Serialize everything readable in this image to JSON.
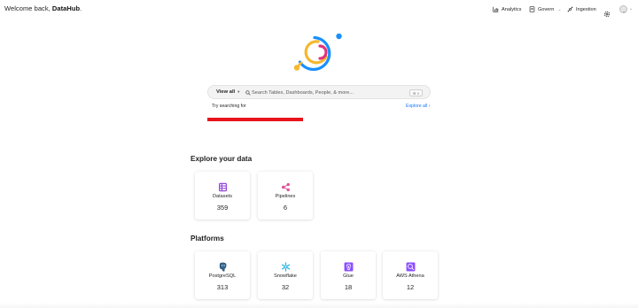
{
  "header": {
    "welcome_prefix": "Welcome back, ",
    "welcome_name": "DataHub",
    "welcome_suffix": ".",
    "nav": {
      "analytics": "Analytics",
      "govern": "Govern",
      "ingestion": "Ingestion"
    },
    "caret": "⌄"
  },
  "search": {
    "scope_label": "View all",
    "scope_caret": "▾",
    "placeholder": "Search Tables, Dashboards, People, & more...",
    "shortcut": "⌘ K",
    "try_label": "Try searching for",
    "explore_all": "Explore all  ›"
  },
  "explore": {
    "title": "Explore your data",
    "cards": [
      {
        "label": "Datasets",
        "count": "359",
        "icon": "dataset-icon",
        "color": "#8c35d9"
      },
      {
        "label": "Pipelines",
        "count": "6",
        "icon": "pipeline-icon",
        "color": "#e04f97"
      }
    ]
  },
  "platforms": {
    "title": "Platforms",
    "cards": [
      {
        "label": "PostgreSQL",
        "count": "313",
        "icon": "postgresql-icon",
        "color": "#336791"
      },
      {
        "label": "Snowflake",
        "count": "32",
        "icon": "snowflake-icon",
        "color": "#29b5e8"
      },
      {
        "label": "Glue",
        "count": "18",
        "icon": "aws-glue-icon",
        "color": "#8c4fff"
      },
      {
        "label": "AWS Athena",
        "count": "12",
        "icon": "aws-athena-icon",
        "color": "#8c4fff"
      }
    ]
  },
  "colors": {
    "accent": "#1677ff",
    "logo_blue": "#1890ff",
    "logo_yellow": "#f5b72d",
    "logo_pink": "#e0337d",
    "redaction": "#e8141c"
  }
}
